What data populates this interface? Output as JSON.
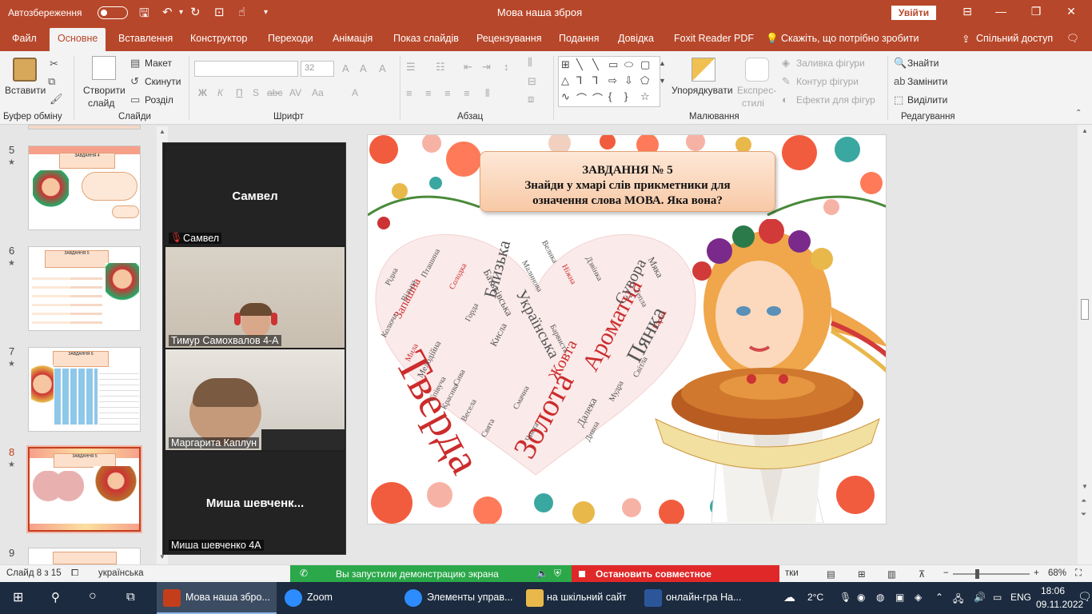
{
  "titlebar": {
    "autosave": "Автозбереження",
    "doc_title": "Мова наша зброя",
    "signin": "Увійти"
  },
  "tabs": [
    "Файл",
    "Основне",
    "Вставлення",
    "Конструктор",
    "Переходи",
    "Анімація",
    "Показ слайдів",
    "Рецензування",
    "Подання",
    "Довідка",
    "Foxit Reader PDF"
  ],
  "tell_me": "Скажіть, що потрібно зробити",
  "share": "Спільний доступ",
  "ribbon": {
    "paste": "Вставити",
    "clipboard": "Буфер обміну",
    "new_slide": [
      "Створити",
      "слайд"
    ],
    "layout": "Макет",
    "reset": "Скинути",
    "section": "Розділ",
    "slides": "Слайди",
    "font_size": "32",
    "font_group": "Шрифт",
    "paragraph_group": "Абзац",
    "arrange": "Упорядкувати",
    "quick_styles": [
      "Експрес-",
      "стилі"
    ],
    "fill": "Заливка фігури",
    "outline": "Контур фігури",
    "effects": "Ефекти для фігур",
    "drawing_group": "Малювання",
    "find": "Знайти",
    "replace": "Замінити",
    "select": "Виділити",
    "editing_group": "Редагування",
    "bold": "Ж",
    "italic": "К",
    "underline": "П",
    "strike": "abc",
    "case": "Aa"
  },
  "thumbnails": [
    {
      "num": "5",
      "title": "ЗАВДАННЯ 4"
    },
    {
      "num": "6",
      "title": "ЗАВДАННЯ 5"
    },
    {
      "num": "7",
      "title": "ЗАВДАННЯ 6"
    },
    {
      "num": "8",
      "title": "ЗАВДАННЯ 5"
    },
    {
      "num": "9",
      "title": ""
    }
  ],
  "zoom": {
    "tiles": [
      {
        "center": "Самвел",
        "label": "Самвел"
      },
      {
        "center": "",
        "label": "Тимур Самохвалов 4-А"
      },
      {
        "center": "",
        "label": "Маргарита Каплун"
      },
      {
        "center": "Миша  шевченк...",
        "label": "Миша шевченко 4А"
      }
    ]
  },
  "slide": {
    "task_title": "ЗАВДАННЯ № 5",
    "task_line1": "Знайди у хмарі слів прикметники для",
    "task_line2": "означення слова МОВА. Яка вона?",
    "words": [
      "Тверда",
      "Золота",
      "Ароматна",
      "Пянка",
      "Близька",
      "Українська",
      "Жовта",
      "Сувора",
      "Запашна",
      "Мелодійна",
      "Батьківська",
      "Кисла",
      "Далека",
      "Солодка",
      "Красива",
      "Ніжна",
      "Смачна",
      "Рідна",
      "Мила",
      "Весела",
      "Тепла",
      "Гарна",
      "Дзвінка",
      "Співуча",
      "Колюча",
      "Малинова",
      "Мудра",
      "Горда",
      "Свята",
      "Вільна",
      "Барвиста",
      "Світла",
      "Сива",
      "Пташина",
      "Чиста",
      "Дивна",
      "Мяка",
      "Велика"
    ]
  },
  "status": {
    "slide_of": "Слайд 8 з 15",
    "language": "українська",
    "sharing": "Вы запустили демонстрацию экрана",
    "stop": "Остановить совместное использование",
    "notes_tail": "тки",
    "zoom_pct": "68%"
  },
  "taskbar": {
    "items": [
      {
        "label": "Мова наша збро...",
        "color": "#c43e1c"
      },
      {
        "label": "Zoom",
        "color": "#2d8cff"
      },
      {
        "label": "Элементы управ...",
        "color": "#2d8cff"
      },
      {
        "label": "на шкільний сайт",
        "color": "#e8b84a"
      },
      {
        "label": "онлайн-гра На...",
        "color": "#2b579a"
      }
    ],
    "weather": "2°C",
    "lang": "ENG",
    "time": "18:06",
    "date": "09.11.2022"
  }
}
